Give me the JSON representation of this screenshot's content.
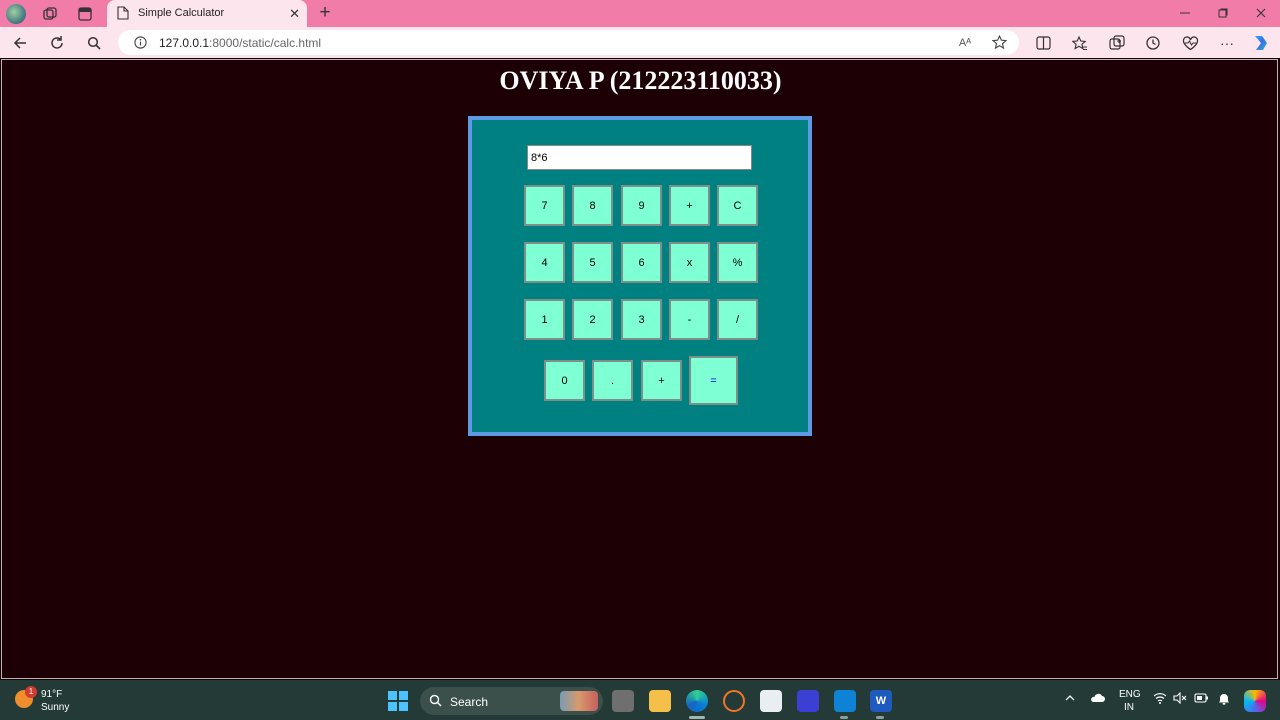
{
  "browser": {
    "tab_title": "Simple Calculator",
    "url_host": "127.0.0.1",
    "url_path": ":8000/static/calc.html",
    "read_aloud_label": "Aᴬ"
  },
  "page": {
    "heading": "OVIYA P (212223110033)"
  },
  "calculator": {
    "display_value": "8*6",
    "keys": [
      "7",
      "8",
      "9",
      "+",
      "C",
      "4",
      "5",
      "6",
      "x",
      "%",
      "1",
      "2",
      "3",
      "-",
      "/",
      "0",
      ".",
      "+",
      "="
    ]
  },
  "taskbar": {
    "weather_temp": "91°F",
    "weather_condition": "Sunny",
    "weather_badge": "1",
    "search_label": "Search",
    "lang_line1": "ENG",
    "lang_line2": "IN",
    "word_letter": "W"
  },
  "colors": {
    "tab_bar": "#f27ca8",
    "nav_bar": "#fde5ee",
    "page_background": "#1c0005",
    "calculator_panel": "#008080",
    "calculator_border": "#5e9ae4",
    "key_fill": "#7fffd4",
    "equals_text": "#0000ee"
  }
}
